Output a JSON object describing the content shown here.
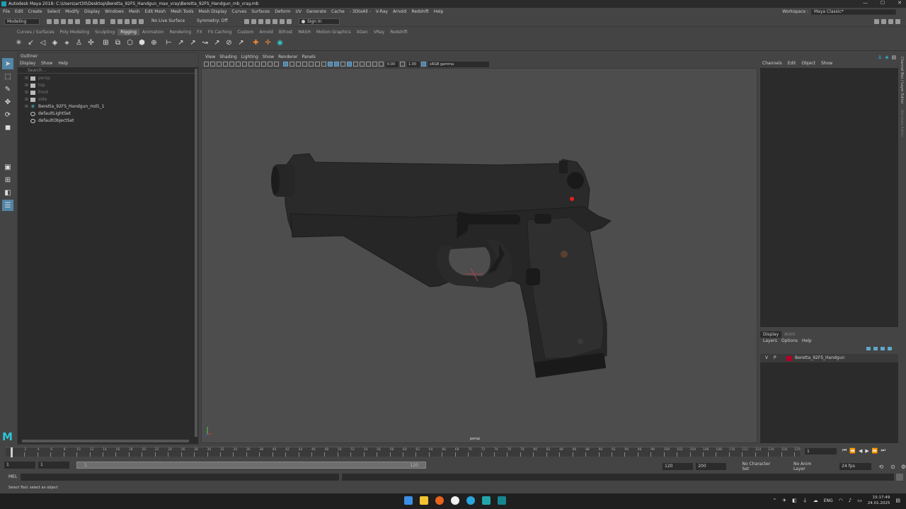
{
  "window": {
    "title": "Autodesk Maya 2018: C:\\Users\\art30\\Desktop\\Beretta_92FS_Handgun_max_vray\\Beretta_92FS_Handgun_mb_vray.mb",
    "controls": [
      "—",
      "☐",
      "✕"
    ]
  },
  "menubar": {
    "items": [
      "File",
      "Edit",
      "Create",
      "Select",
      "Modify",
      "Display",
      "Windows",
      "Mesh",
      "Edit Mesh",
      "Mesh Tools",
      "Mesh Display",
      "Curves",
      "Surfaces",
      "Deform",
      "UV",
      "Generate",
      "Cache",
      "- 3DtoAll -",
      "V-Ray",
      "Arnold",
      "Redshift",
      "Help"
    ],
    "workspace_label": "Workspace :",
    "workspace_value": "Maya Classic*"
  },
  "statusline": {
    "menuset": "Modeling",
    "live_surface": "No Live Surface",
    "symmetry": "Symmetry: Off",
    "sign_in": "Sign In"
  },
  "shelf": {
    "tabs": [
      "Curves / Surfaces",
      "Poly Modeling",
      "Sculpting",
      "Rigging",
      "Animation",
      "Rendering",
      "FX",
      "FX Caching",
      "Custom",
      "Arnold",
      "Bifrost",
      "MASH",
      "Motion Graphics",
      "XGen",
      "VRay",
      "Redshift"
    ],
    "active_tab": "Rigging"
  },
  "outliner": {
    "title": "Outliner",
    "menu": [
      "Display",
      "Show",
      "Help"
    ],
    "search_placeholder": "Search...",
    "items": [
      {
        "label": "persp",
        "type": "camera",
        "dim": true
      },
      {
        "label": "top",
        "type": "camera",
        "dim": true
      },
      {
        "label": "front",
        "type": "camera",
        "dim": true
      },
      {
        "label": "side",
        "type": "camera",
        "dim": true
      },
      {
        "label": "Beretta_92FS_Handgun_md1_1",
        "type": "joint",
        "dim": false
      },
      {
        "label": "defaultLightSet",
        "type": "set",
        "dim": false
      },
      {
        "label": "defaultObjectSet",
        "type": "set",
        "dim": false
      }
    ]
  },
  "viewport": {
    "menu": [
      "View",
      "Shading",
      "Lighting",
      "Show",
      "Renderer",
      "Panels"
    ],
    "exposure": "0.00",
    "gamma": "1.00",
    "color_space": "sRGB gamma",
    "camera_label": "persp"
  },
  "channelbox": {
    "menu": [
      "Channels",
      "Edit",
      "Object",
      "Show"
    ],
    "side_tabs": [
      "Channel Box / Layer Editor",
      "Attribute Editor"
    ]
  },
  "layers": {
    "tabs": [
      "Display",
      "Anim"
    ],
    "menu": [
      "Layers",
      "Options",
      "Help"
    ],
    "rows": [
      {
        "v": "V",
        "p": "P",
        "name": "Beretta_92FS_Handgun",
        "color": "#b3002a"
      }
    ]
  },
  "timeslider": {
    "ticks": [
      "1",
      "2",
      "4",
      "6",
      "8",
      "10",
      "12",
      "14",
      "16",
      "18",
      "20",
      "22",
      "24",
      "26",
      "28",
      "30",
      "32",
      "34",
      "36",
      "38",
      "40",
      "42",
      "44",
      "46",
      "48",
      "50",
      "52",
      "54",
      "56",
      "58",
      "60",
      "62",
      "64",
      "66",
      "68",
      "70",
      "72",
      "74",
      "76",
      "78",
      "80",
      "82",
      "84",
      "86",
      "88",
      "90",
      "92",
      "94",
      "96",
      "98",
      "100",
      "102",
      "104",
      "106",
      "108",
      "110",
      "112",
      "114",
      "116",
      "118",
      "120"
    ],
    "current_frame": "1",
    "play_controls": [
      "⏮",
      "⏪",
      "◀",
      "▶",
      "⏩",
      "⏭"
    ]
  },
  "rangeslider": {
    "start": "1",
    "inner_start": "1",
    "bar_start": "1",
    "bar_end": "120",
    "inner_end": "120",
    "end": "200",
    "char_set": "No Character Set",
    "anim_layer": "No Anim Layer",
    "fps": "24 fps"
  },
  "cmdline": {
    "label": "MEL"
  },
  "helpline": {
    "text": "Select Tool: select an object"
  },
  "taskbar": {
    "lang": "ENG",
    "time": "15:17:49",
    "date": "24.01.2025"
  }
}
